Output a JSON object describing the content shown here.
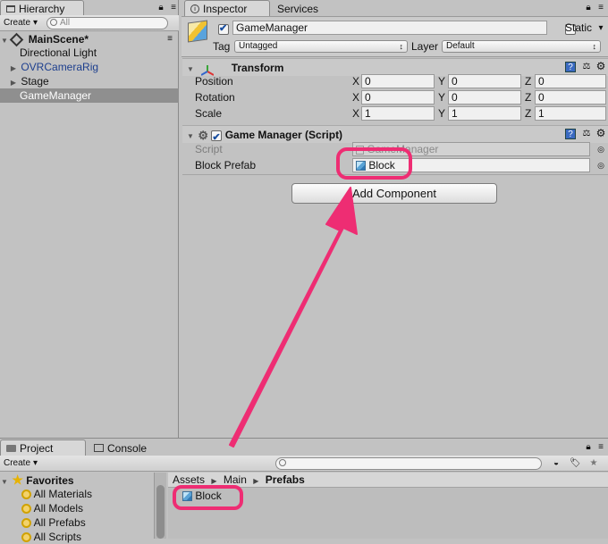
{
  "hierarchy": {
    "tab_label": "Hierarchy",
    "create_label": "Create",
    "search_placeholder": "All",
    "scene_name": "MainScene*",
    "items": [
      {
        "label": "Directional Light",
        "color": "#111111"
      },
      {
        "label": "OVRCameraRig",
        "color": "#1d3f8e",
        "collapsed": true
      },
      {
        "label": "Stage",
        "color": "#111111",
        "collapsed": true
      },
      {
        "label": "GameManager",
        "color": "#ffffff",
        "selected": true
      }
    ]
  },
  "inspector": {
    "tab_label": "Inspector",
    "services_tab_label": "Services",
    "object_name": "GameManager",
    "static_label": "Static",
    "tag_label": "Tag",
    "tag_value": "Untagged",
    "layer_label": "Layer",
    "layer_value": "Default",
    "transform": {
      "title": "Transform",
      "rows": [
        {
          "label": "Position",
          "x": "0",
          "y": "0",
          "z": "0"
        },
        {
          "label": "Rotation",
          "x": "0",
          "y": "0",
          "z": "0"
        },
        {
          "label": "Scale",
          "x": "1",
          "y": "1",
          "z": "1"
        }
      ],
      "axis_x": "X",
      "axis_y": "Y",
      "axis_z": "Z"
    },
    "script_component": {
      "title": "Game Manager (Script)",
      "script_label": "Script",
      "script_value": "GameManager",
      "prefab_label": "Block Prefab",
      "prefab_value": "Block"
    },
    "add_component_label": "Add Component"
  },
  "project": {
    "tab_label": "Project",
    "console_tab_label": "Console",
    "create_label": "Create",
    "favorites_label": "Favorites",
    "favorites": [
      "All Materials",
      "All Models",
      "All Prefabs",
      "All Scripts"
    ],
    "breadcrumb": [
      "Assets",
      "Main",
      "Prefabs"
    ],
    "assets": [
      "Block"
    ]
  },
  "colors": {
    "highlight": "#ee2d73",
    "selection": "#8f8f8f"
  }
}
